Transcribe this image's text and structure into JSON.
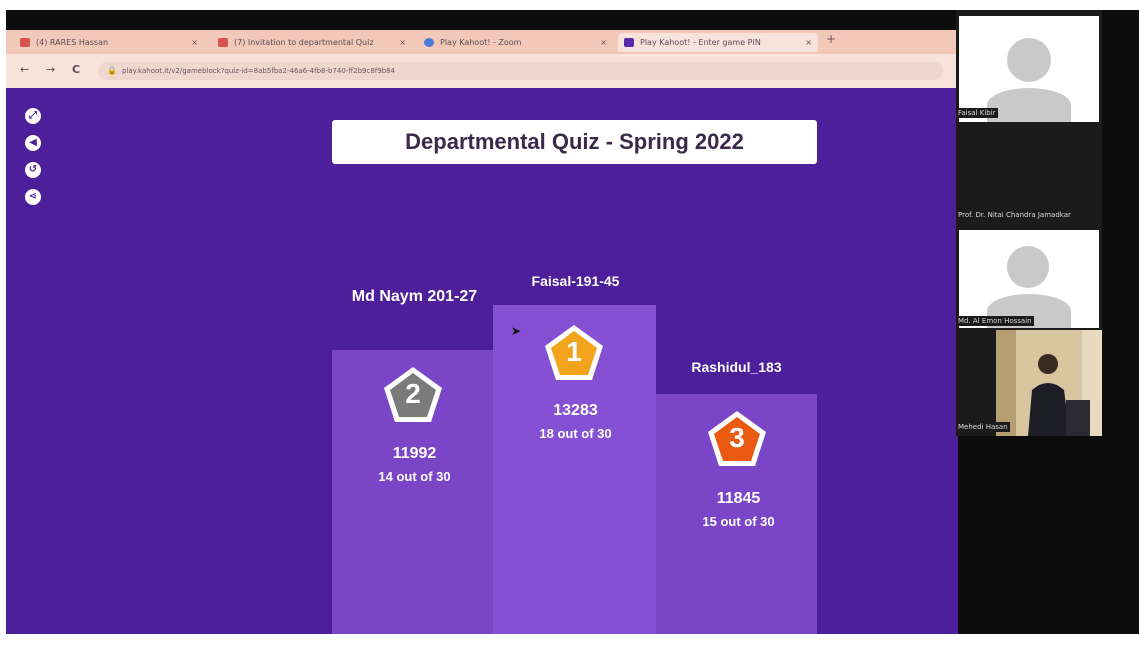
{
  "browser": {
    "tabs": [
      {
        "label": "(4) RARES Hassan",
        "close": "×",
        "color": "#d9534f"
      },
      {
        "label": "(7) Invitation to departmental Quiz",
        "close": "×",
        "color": "#d9534f"
      },
      {
        "label": "Play Kahoot! - Zoom",
        "close": "×",
        "color": "#4a7bd8"
      },
      {
        "label": "Play Kahoot! - Enter game PIN",
        "close": "×",
        "color": "#5b2aa6"
      }
    ],
    "new_tab": "+",
    "back": "←",
    "forward": "→",
    "reload": "C",
    "lock": "🔒",
    "url": "play.kahoot.it/v2/gameblock?quiz-id=8ab5fba2-46a6-4fb8-b740-ff2b9c8f9b84"
  },
  "controls": [
    {
      "icon": "expand-icon",
      "glyph": "⤢"
    },
    {
      "icon": "volume-icon",
      "glyph": "◀"
    },
    {
      "icon": "replay-icon",
      "glyph": "↺"
    },
    {
      "icon": "share-icon",
      "glyph": "⋖"
    }
  ],
  "quiz": {
    "title": "Departmental Quiz - Spring 2022",
    "podium": [
      {
        "rank": "2",
        "name": "Md Naym 201-27",
        "score": "11992",
        "correct": "14 out of 30",
        "badge_color": "#7b7b7b"
      },
      {
        "rank": "1",
        "name": "Faisal-191-45",
        "score": "13283",
        "correct": "18 out of 30",
        "badge_color": "#f2a41d"
      },
      {
        "rank": "3",
        "name": "Rashidul_183",
        "score": "11845",
        "correct": "15 out of 30",
        "badge_color": "#ea5a11"
      }
    ]
  },
  "participants": [
    {
      "name": "Faisal Kibir"
    },
    {
      "name": "Prof. Dr. Nitai Chandra Jamadkar"
    },
    {
      "name": "Md. Al Emon Hossain"
    },
    {
      "name": "Mehedi Hasan"
    }
  ]
}
